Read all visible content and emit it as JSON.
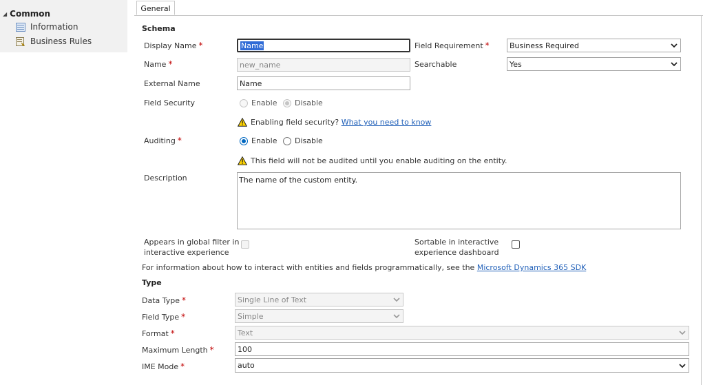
{
  "sidebar": {
    "header": "Common",
    "items": [
      {
        "label": "Information",
        "icon": "information-icon"
      },
      {
        "label": "Business Rules",
        "icon": "business-rules-icon"
      }
    ]
  },
  "tabs": [
    {
      "label": "General",
      "active": true
    }
  ],
  "schema": {
    "title": "Schema",
    "display_name": {
      "label": "Display Name",
      "value": "Name"
    },
    "name": {
      "label": "Name",
      "value": "new_name"
    },
    "external_name": {
      "label": "External Name",
      "value": "Name"
    },
    "field_requirement": {
      "label": "Field Requirement",
      "value": "Business Required"
    },
    "searchable": {
      "label": "Searchable",
      "value": "Yes"
    },
    "field_security": {
      "label": "Field Security",
      "enable": "Enable",
      "disable": "Disable",
      "selected": "Disable"
    },
    "security_warning": {
      "text": "Enabling field security?",
      "link": "What you need to know"
    },
    "auditing": {
      "label": "Auditing",
      "enable": "Enable",
      "disable": "Disable",
      "selected": "Enable"
    },
    "auditing_warning": "This field will not be audited until you enable auditing on the entity.",
    "description": {
      "label": "Description",
      "value": "The name of the custom entity."
    },
    "global_filter": {
      "label_line1": "Appears in global filter in",
      "label_line2": "interactive experience"
    },
    "sortable": {
      "label_line1": "Sortable in interactive",
      "label_line2": "experience dashboard"
    },
    "sdk_info": {
      "text": "For information about how to interact with entities and fields programmatically, see the",
      "link": "Microsoft Dynamics 365 SDK"
    }
  },
  "type": {
    "title": "Type",
    "data_type": {
      "label": "Data Type",
      "value": "Single Line of Text"
    },
    "field_type": {
      "label": "Field Type",
      "value": "Simple"
    },
    "format": {
      "label": "Format",
      "value": "Text"
    },
    "max_length": {
      "label": "Maximum Length",
      "value": "100"
    },
    "ime_mode": {
      "label": "IME Mode",
      "value": "auto"
    }
  },
  "required_marker": "*",
  "colors": {
    "required": "#c00000",
    "link": "#1f5fb8",
    "radio_selected": "#0067c0",
    "sidebar_bg": "#f1f1f1"
  }
}
